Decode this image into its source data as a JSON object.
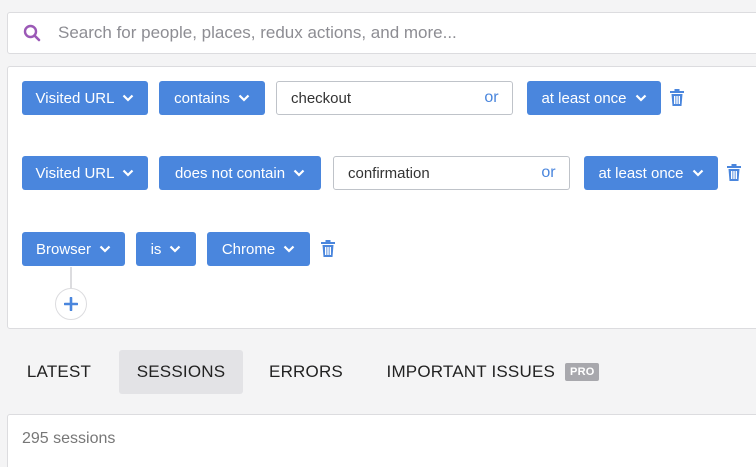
{
  "search": {
    "placeholder": "Search for people, places, redux actions, and more..."
  },
  "filters": [
    {
      "field": "Visited URL",
      "operator": "contains",
      "value": "checkout",
      "or_label": "or",
      "frequency": "at least once"
    },
    {
      "field": "Visited URL",
      "operator": "does not contain",
      "value": "confirmation",
      "or_label": "or",
      "frequency": "at least once"
    },
    {
      "field": "Browser",
      "operator": "is",
      "value": "Chrome"
    }
  ],
  "tabs": [
    {
      "label": "LATEST"
    },
    {
      "label": "SESSIONS",
      "active": true
    },
    {
      "label": "ERRORS"
    },
    {
      "label": "IMPORTANT ISSUES",
      "badge": "PRO"
    }
  ],
  "results": {
    "count_text": "295 sessions"
  },
  "colors": {
    "accent": "#4a86dd",
    "search_icon": "#9b59b6",
    "badge": "#a8a8ad"
  },
  "icons": {
    "search": "search-icon",
    "dropdown": "chevron-down-icon",
    "delete": "trash-icon",
    "add": "plus-icon"
  }
}
